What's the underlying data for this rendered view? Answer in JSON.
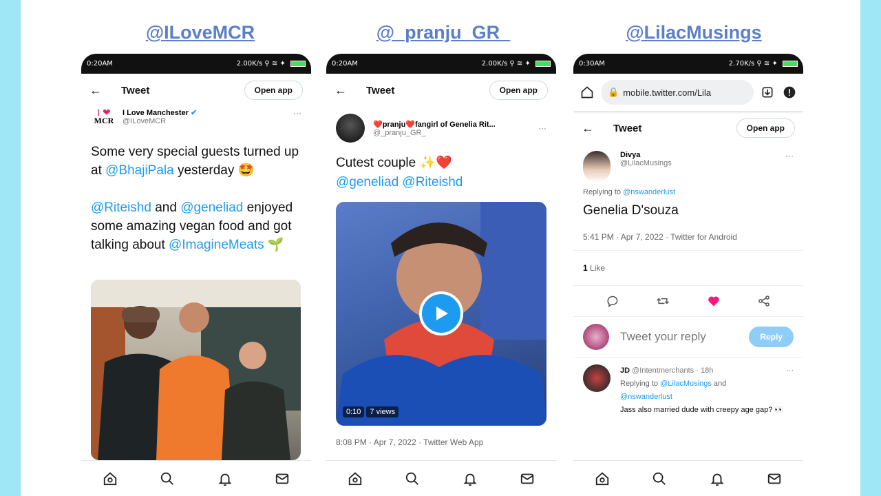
{
  "captions": [
    "@ILoveMCR",
    "@_pranju_GR_",
    "@LilacMusings"
  ],
  "phone1": {
    "status": {
      "time": "0:20AM",
      "right": "2.00K/s"
    },
    "header": {
      "back": "←",
      "title": "Tweet",
      "open_app": "Open app"
    },
    "author": {
      "name": "I Love Manchester",
      "handle": "@ILoveMCR",
      "logo_text": "MCR",
      "more": "···"
    },
    "text": {
      "line1": "Some very special guests turned up at ",
      "mention1": "@BhajiPala",
      "line1b": " yesterday 🤩",
      "mention2": "@Riteishd",
      "and": " and ",
      "mention3": "@geneliad",
      "line2": " enjoyed some amazing vegan food and got talking about ",
      "mention4": "@ImagineMeats",
      "emoji": " 🌱"
    }
  },
  "phone2": {
    "status": {
      "time": "0:20AM",
      "right": "2.00K/s"
    },
    "header": {
      "back": "←",
      "title": "Tweet",
      "open_app": "Open app"
    },
    "author": {
      "name": "❤️pranju❤️fangirl of Genelia Rit...",
      "handle": "@_pranju_GR_",
      "more": "···"
    },
    "text": {
      "line1": "Cutest couple ✨❤️",
      "mention1": "@geneliad",
      "mention2": "@Riteishd"
    },
    "video": {
      "duration": "0:10",
      "views": "7 views"
    },
    "meta": "8:08 PM · Apr 7, 2022 · Twitter Web App"
  },
  "phone3": {
    "status": {
      "time": "0:30AM",
      "right": "2.70K/s"
    },
    "browser": {
      "url": "mobile.twitter.com/Lila"
    },
    "header": {
      "back": "←",
      "title": "Tweet",
      "open_app": "Open app"
    },
    "author": {
      "name": "Divya",
      "handle": "@LilacMusings",
      "more": "···"
    },
    "replying": {
      "prefix": "Replying to ",
      "to": "@nswanderlust"
    },
    "text": "Genelia D'souza",
    "meta": "5:41 PM · Apr 7, 2022 · Twitter for Android",
    "likes": {
      "count": "1",
      "label": "Like"
    },
    "reply_box": {
      "placeholder": "Tweet your reply",
      "button": "Reply"
    },
    "reply": {
      "name": "JD",
      "handle": "@Intentmerchants",
      "time": "· 18h",
      "more": "···",
      "replying_prefix": "Replying to ",
      "replying_to1": "@LilacMusings",
      "replying_and": " and",
      "replying_to2": "@nswanderlust",
      "text": "Jass also married dude with creepy age gap? 👀"
    }
  },
  "colors": {
    "accent": "#1d9bf0",
    "caption": "#5b7fc8",
    "heart": "#f91880",
    "bg": "#9fe6f7"
  }
}
